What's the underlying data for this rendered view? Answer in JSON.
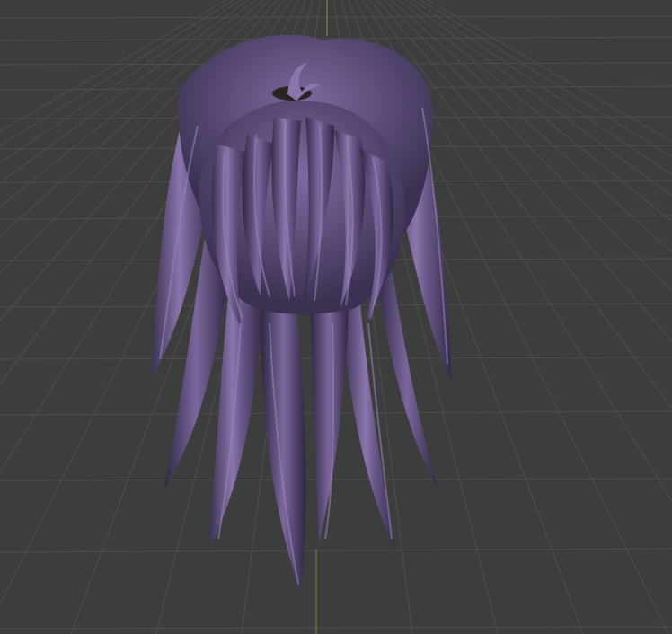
{
  "viewport": {
    "background": "#3d3d3d",
    "grid_color": "#4f4f4f",
    "axis_y_color": "#7d9a3e",
    "axis_z_color": "#6e8a3a"
  },
  "model": {
    "object": "hair-mesh",
    "base_color": "#5e4d78",
    "highlight_color": "#9a86bd",
    "shadow_color": "#2e2540",
    "tie_color": "#2a2422"
  }
}
